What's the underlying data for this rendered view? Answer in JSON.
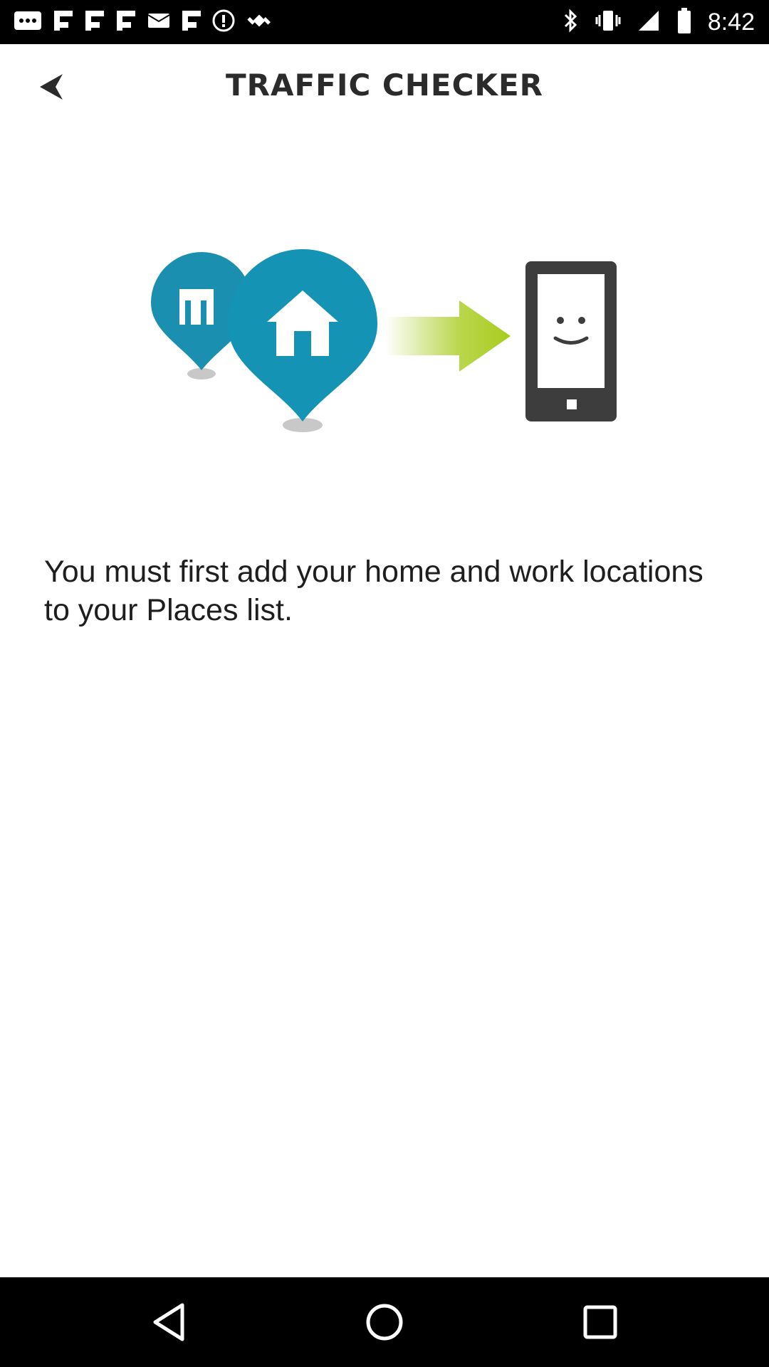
{
  "status_bar": {
    "time": "8:42",
    "left_icons": [
      "more-icon",
      "flipboard-icon",
      "flipboard-icon",
      "flipboard-icon",
      "mail-icon",
      "flipboard-icon",
      "alert-icon",
      "satellite-icon"
    ],
    "right_icons": [
      "bluetooth-icon",
      "vibrate-icon",
      "data-off-icon",
      "battery-icon"
    ]
  },
  "header": {
    "title": "TRAFFIC CHECKER",
    "back_icon": "back-arrow-icon"
  },
  "illustration": {
    "icons": [
      "work-location-pin-icon",
      "home-location-pin-icon",
      "arrow-right-icon",
      "smartphone-smiley-icon"
    ],
    "colors": {
      "pin_primary": "#1793b4",
      "pin_secondary": "#2aa8c8",
      "arrow": "#a8cc1e",
      "phone": "#3d3d3d"
    }
  },
  "main": {
    "message": "You must first add your home and work locations to your Places list."
  },
  "nav_bar": {
    "buttons": [
      "back-nav-icon",
      "home-nav-icon",
      "recents-nav-icon"
    ]
  }
}
